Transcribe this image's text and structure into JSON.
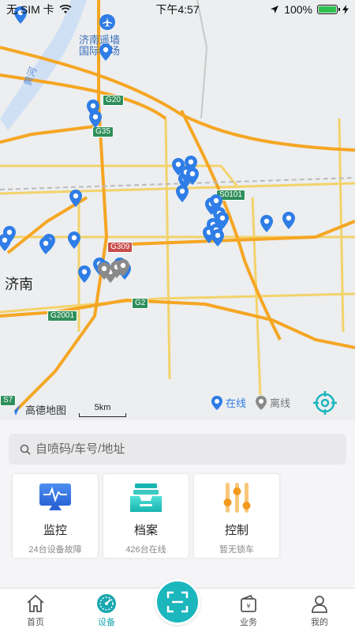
{
  "status_bar": {
    "carrier": "无 SIM 卡",
    "time": "下午4:57",
    "battery": "100%",
    "battery_level": 1.0
  },
  "map": {
    "airport_label": "济南遥墙\n国际机场",
    "city_label": "济南",
    "river_label": "黄河",
    "roads": [
      "G20",
      "G35",
      "S0101",
      "G309",
      "G2",
      "G2001",
      "S7"
    ],
    "pins_online_count": 31,
    "pins_offline_count": 4,
    "legend": {
      "online": "在线",
      "offline": "离线"
    },
    "logo": "高德地图",
    "scale": "5km",
    "colors": {
      "online": "#2f7de6",
      "offline": "#8a8a8a",
      "highway": "#f5a623",
      "arterial": "#f3d36b"
    }
  },
  "search": {
    "placeholder": "自喷码/车号/地址"
  },
  "cards": [
    {
      "title": "监控",
      "subtitle": "24台设备故障",
      "icon": "monitor-icon"
    },
    {
      "title": "档案",
      "subtitle": "426台在线",
      "icon": "archive-tray-icon"
    },
    {
      "title": "控制",
      "subtitle": "暂无锁车",
      "icon": "control-sliders-icon"
    }
  ],
  "tabs": [
    {
      "label": "首页",
      "icon": "home-icon",
      "active": false
    },
    {
      "label": "设备",
      "icon": "device-dial-icon",
      "active": true
    },
    {
      "label": "",
      "icon": "scan-icon",
      "active": false
    },
    {
      "label": "业务",
      "icon": "wallet-icon",
      "active": false
    },
    {
      "label": "我的",
      "icon": "user-icon",
      "active": false
    }
  ],
  "accent_color": "#1cb6bd"
}
